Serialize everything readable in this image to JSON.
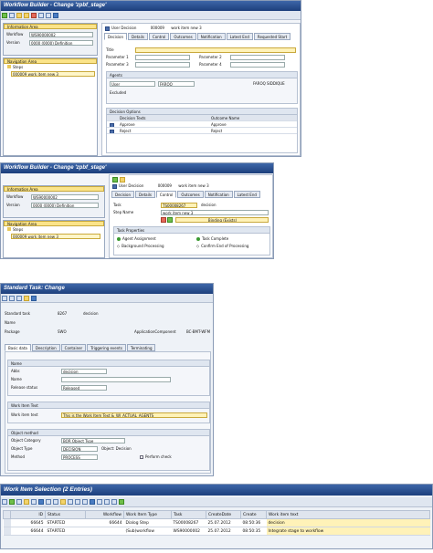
{
  "panel1": {
    "title": "Workflow Builder - Change 'zpbf_stage'",
    "info_area": "Information Area",
    "workflow_label": "Workflow",
    "workflow_value": "WS90000002",
    "version_label": "Version",
    "version_value": "0000 (0000) Definition",
    "nav_area": "Navigation Area",
    "steps": "Steps",
    "step_item_id": "000009",
    "step_item_text": "work item new 3",
    "user_decision": "User Decision",
    "decision_no": "000009",
    "decision_name": "work item new 3",
    "tabs": [
      "Decision",
      "Details",
      "Control",
      "Outcomes",
      "Notification",
      "Latest End",
      "Requested Start"
    ],
    "title_label": "Title",
    "param1": "Parameter 1",
    "param2": "Parameter 2",
    "param3": "Parameter 3",
    "param4": "Parameter 4",
    "agents_label": "Agents",
    "user_label": "User",
    "user_value": "FAROQ",
    "agent_name": "FAROQ SIDDIQUE",
    "excluded_label": "Excluded",
    "options_title": "Decision Options",
    "col_text": "Decision Texts",
    "col_outcome": "Outcome Name",
    "options": [
      {
        "text": "Approve",
        "outcome": "Approve"
      },
      {
        "text": "Reject",
        "outcome": "Reject"
      }
    ]
  },
  "panel2": {
    "title": "Workflow Builder - Change 'zpbf_stage'",
    "info_area": "Information Area",
    "workflow_label": "Workflow",
    "workflow_value": "WS90000002",
    "version_label": "Version",
    "version_value": "0000 (0000) Definition",
    "nav_area": "Navigation Area",
    "steps": "Steps",
    "step_item": "000009 work item new 3",
    "user_decision": "User Decision",
    "decision_no": "000009",
    "decision_name": "work item new 3",
    "tabs": [
      "Decision",
      "Details",
      "Control",
      "Outcomes",
      "Notification",
      "Latest End"
    ],
    "task_label": "Task",
    "task_value": "TS00008267",
    "task_desc": "decision",
    "step_name_label": "Step Name",
    "step_name_value": "work item new 3",
    "binding": "Binding (Exists)",
    "props_title": "Task Properties",
    "prop1": "Agent Assignment",
    "prop2": "Task Complete",
    "prop3": "Background Processing",
    "prop4": "Confirm End of Processing"
  },
  "panel3": {
    "title": "Standard Task: Change",
    "std_task_label": "Standard task",
    "std_task_value": "8267",
    "std_task_desc": "decision",
    "name_label": "Name",
    "package_label": "Package",
    "package_value": "SWO",
    "appcomp_label": "ApplicationComponent",
    "appcomp_value": "BC-BMT-WFM",
    "tabs": [
      "Basic data",
      "Description",
      "Container",
      "Triggering events",
      "Terminating"
    ],
    "name_section": "Name",
    "abbr_label": "Abbr.",
    "abbr_value": "decision",
    "name2_label": "Name",
    "release_label": "Release status",
    "release_value": "Released",
    "wi_text_section": "Work Item Text",
    "wi_text_label": "Work item text",
    "wi_text_value": "This is the Work Item Text &_WI_ACTUAL_AGENTS",
    "obj_method_section": "Object method",
    "obj_cat_label": "Object Category",
    "obj_cat_value": "BOR Object Type",
    "obj_type_label": "Object Type",
    "obj_type_value": "DECISION",
    "obj_type_desc": "Object: Decision",
    "method_label": "Method",
    "method_value": "PROCESS",
    "perform_check": "Perform check"
  },
  "panel4": {
    "title": "Work Item Selection (2 Entries)",
    "headers": [
      "ID",
      "Status",
      "Workflow",
      "Work Item Type",
      "Task",
      "CreateDate",
      "Create",
      "Work item text"
    ],
    "rows": [
      [
        "66645",
        "STARTED",
        "66644",
        "Dialog Step",
        "TS00008267",
        "25.07.2012",
        "08:50:36",
        "decision"
      ],
      [
        "66644",
        "STARTED",
        "",
        "(Sub)workflow",
        "WS90000002",
        "25.07.2012",
        "08:50:35",
        "Integrate stage to workflow"
      ]
    ]
  }
}
